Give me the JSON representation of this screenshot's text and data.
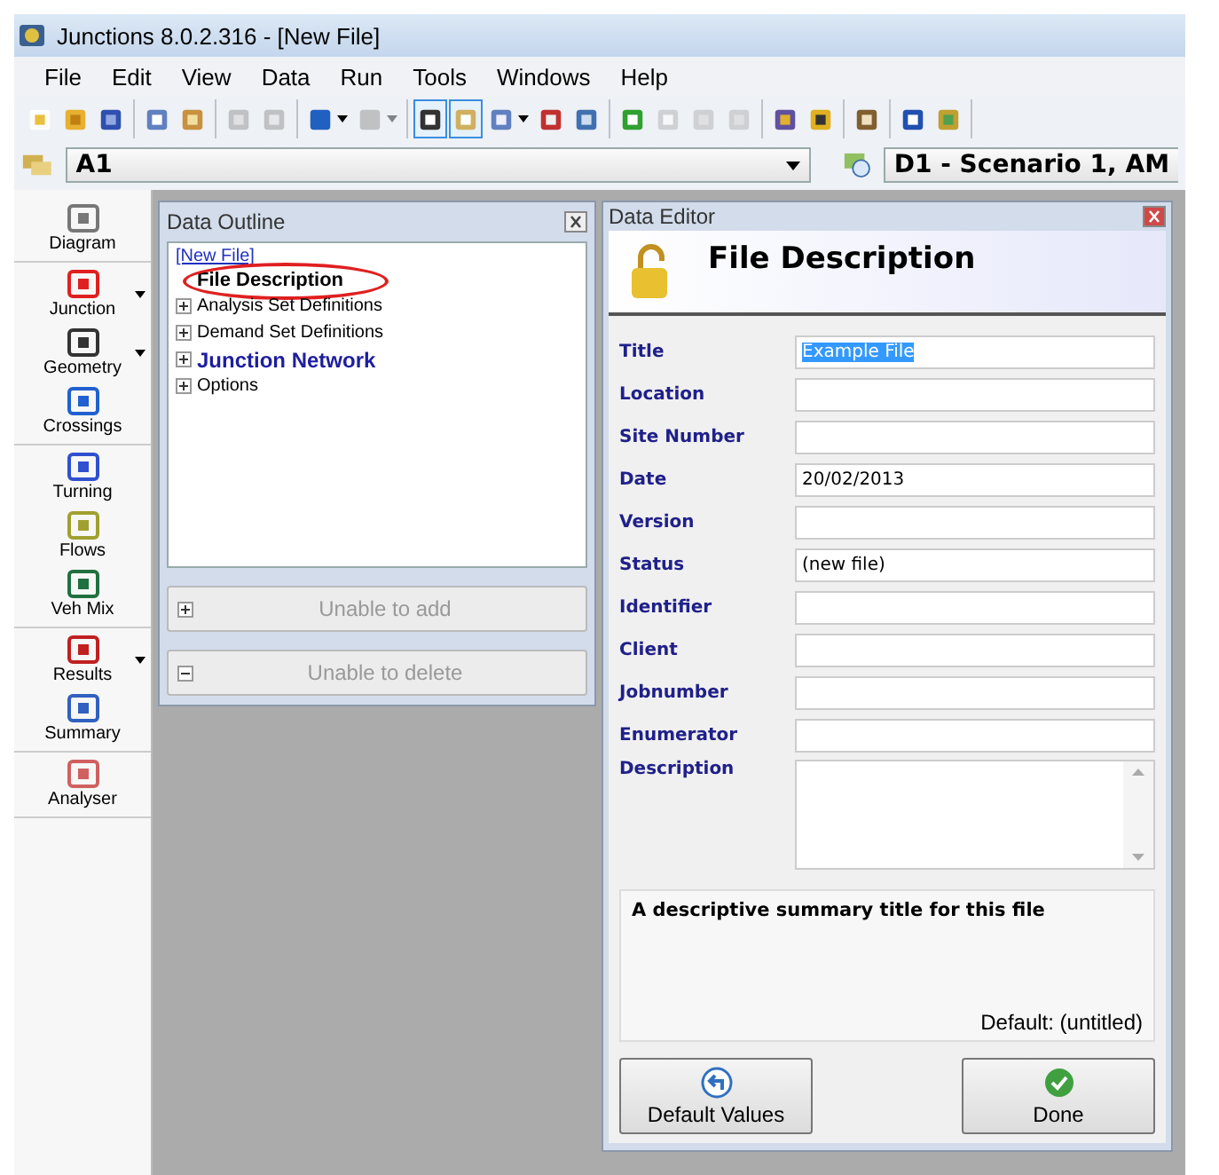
{
  "window": {
    "title": "Junctions 8.0.2.316 - [New File]"
  },
  "menu": [
    "File",
    "Edit",
    "View",
    "Data",
    "Run",
    "Tools",
    "Windows",
    "Help"
  ],
  "toolbar": [
    [
      {
        "disabled": false,
        "pressed": false,
        "dropdown": false
      },
      {
        "disabled": false,
        "pressed": false,
        "dropdown": false
      },
      {
        "disabled": false,
        "pressed": false,
        "dropdown": false
      }
    ],
    [
      {
        "disabled": false,
        "pressed": false,
        "dropdown": false
      },
      {
        "disabled": false,
        "pressed": false,
        "dropdown": false
      }
    ],
    [
      {
        "disabled": true,
        "pressed": false,
        "dropdown": false
      },
      {
        "disabled": true,
        "pressed": false,
        "dropdown": false
      }
    ],
    [
      {
        "disabled": false,
        "pressed": false,
        "dropdown": true
      },
      {
        "disabled": true,
        "pressed": false,
        "dropdown": true
      }
    ],
    [
      {
        "disabled": false,
        "pressed": true,
        "dropdown": false
      },
      {
        "disabled": false,
        "pressed": true,
        "dropdown": false
      },
      {
        "disabled": false,
        "pressed": false,
        "dropdown": true
      },
      {
        "disabled": false,
        "pressed": false,
        "dropdown": false
      },
      {
        "disabled": false,
        "pressed": false,
        "dropdown": false
      }
    ],
    [
      {
        "disabled": false,
        "pressed": false,
        "dropdown": false
      },
      {
        "disabled": true,
        "pressed": false,
        "dropdown": false
      },
      {
        "disabled": true,
        "pressed": false,
        "dropdown": false
      },
      {
        "disabled": true,
        "pressed": false,
        "dropdown": false
      }
    ],
    [
      {
        "disabled": false,
        "pressed": false,
        "dropdown": false
      },
      {
        "disabled": false,
        "pressed": false,
        "dropdown": false
      }
    ],
    [
      {
        "disabled": false,
        "pressed": false,
        "dropdown": false
      }
    ],
    [
      {
        "disabled": false,
        "pressed": false,
        "dropdown": false
      },
      {
        "disabled": false,
        "pressed": false,
        "dropdown": false
      }
    ]
  ],
  "selectors": {
    "analysis_set": "A1",
    "demand_set": "D1 - Scenario 1, AM"
  },
  "sidebar": {
    "groups": [
      [
        {
          "label": "Diagram",
          "dropdown": false
        }
      ],
      [
        {
          "label": "Junction",
          "dropdown": true
        },
        {
          "label": "Geometry",
          "dropdown": true
        },
        {
          "label": "Crossings",
          "dropdown": false
        }
      ],
      [
        {
          "label": "Turning",
          "dropdown": false
        },
        {
          "label": "Flows",
          "dropdown": false
        },
        {
          "label": "Veh Mix",
          "dropdown": false
        }
      ],
      [
        {
          "label": "Results",
          "dropdown": true
        },
        {
          "label": "Summary",
          "dropdown": false
        }
      ],
      [
        {
          "label": "Analyser",
          "dropdown": false
        }
      ]
    ]
  },
  "data_outline": {
    "title": "Data Outline",
    "root": "[New File]",
    "children": [
      {
        "label": "File Description",
        "kind": "leaf",
        "selected": true,
        "circled": true,
        "emphasis": false
      },
      {
        "label": "Analysis Set Definitions",
        "kind": "branch",
        "selected": false,
        "circled": false,
        "emphasis": false
      },
      {
        "label": "Demand Set Definitions",
        "kind": "branch",
        "selected": false,
        "circled": false,
        "emphasis": false
      },
      {
        "label": "Junction Network",
        "kind": "branch",
        "selected": false,
        "circled": false,
        "emphasis": true
      },
      {
        "label": "Options",
        "kind": "branch",
        "selected": false,
        "circled": false,
        "emphasis": false
      }
    ],
    "buttons": [
      {
        "kind": "add",
        "label": "Unable to add",
        "disabled": true
      },
      {
        "kind": "delete",
        "label": "Unable to delete",
        "disabled": true
      }
    ]
  },
  "data_editor": {
    "title": "Data Editor",
    "heading": "File Description",
    "fields": [
      {
        "label": "Title",
        "kind": "text",
        "value": "Example File",
        "text_selected": true
      },
      {
        "label": "Location",
        "kind": "text"
      },
      {
        "label": "Site Number",
        "kind": "text"
      },
      {
        "label": "Date",
        "kind": "text",
        "value": "20/02/2013",
        "text_selected": false
      },
      {
        "label": "Version",
        "kind": "text"
      },
      {
        "label": "Status",
        "kind": "text",
        "value": "(new file)",
        "text_selected": false
      },
      {
        "label": "Identifier",
        "kind": "text"
      },
      {
        "label": "Client",
        "kind": "text"
      },
      {
        "label": "Jobnumber",
        "kind": "text"
      },
      {
        "label": "Enumerator",
        "kind": "text"
      },
      {
        "label": "Description",
        "kind": "multiline"
      }
    ],
    "help": {
      "text": "A descriptive summary title for this file",
      "default": "Default: (untitled)"
    },
    "buttons": [
      {
        "kind": "defaults",
        "label": "Default Values"
      },
      {
        "kind": "done",
        "label": "Done"
      }
    ]
  }
}
